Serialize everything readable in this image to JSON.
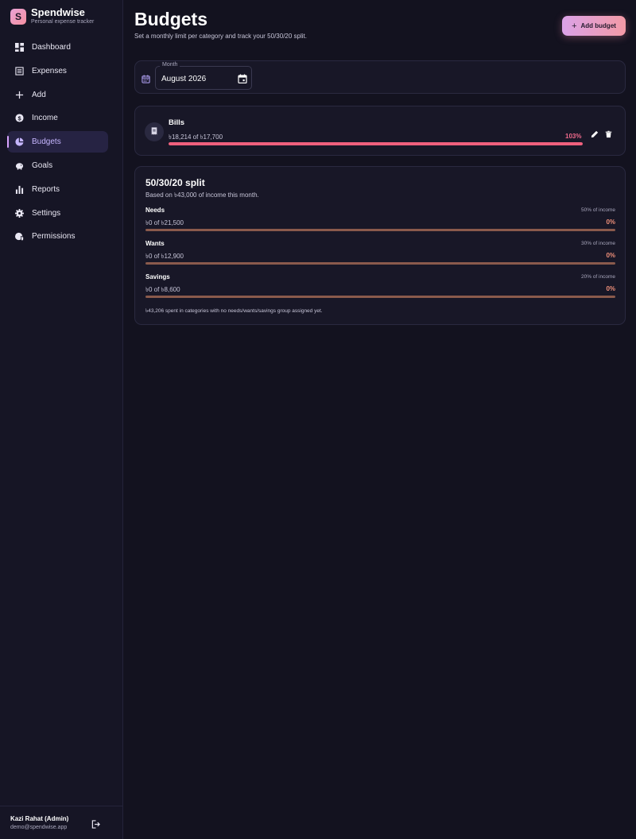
{
  "brand": {
    "logo_letter": "S",
    "name": "Spendwise",
    "tagline": "Personal expense tracker"
  },
  "nav": [
    {
      "label": "Dashboard",
      "icon": "dashboard-icon",
      "active": false
    },
    {
      "label": "Expenses",
      "icon": "receipt-icon",
      "active": false
    },
    {
      "label": "Add",
      "icon": "plus-icon",
      "active": false
    },
    {
      "label": "Income",
      "icon": "dollar-icon",
      "active": false
    },
    {
      "label": "Budgets",
      "icon": "pie-chart-icon",
      "active": true
    },
    {
      "label": "Goals",
      "icon": "piggy-bank-icon",
      "active": false
    },
    {
      "label": "Reports",
      "icon": "bar-chart-icon",
      "active": false
    },
    {
      "label": "Settings",
      "icon": "gear-icon",
      "active": false
    },
    {
      "label": "Permissions",
      "icon": "user-shield-icon",
      "active": false
    }
  ],
  "user": {
    "name": "Kazi Rahat (Admin)",
    "email": "demo@spendwise.app"
  },
  "header": {
    "title": "Budgets",
    "subtitle": "Set a monthly limit per category and track your 50/30/20 split.",
    "add_button": "Add budget"
  },
  "month": {
    "label": "Month",
    "value": "August 2026"
  },
  "budgets": [
    {
      "name": "Bills",
      "amount": "৳18,214 of ৳17,700",
      "percent_label": "103%",
      "progress": 1.0
    }
  ],
  "split": {
    "title": "50/30/20 split",
    "subtitle": "Based on ৳43,000 of income this month.",
    "rows": [
      {
        "name": "Needs",
        "share": "50% of income",
        "amount": "৳0 of ৳21,500",
        "percent_label": "0%",
        "progress": 0
      },
      {
        "name": "Wants",
        "share": "30% of income",
        "amount": "৳0 of ৳12,900",
        "percent_label": "0%",
        "progress": 0
      },
      {
        "name": "Savings",
        "share": "20% of income",
        "amount": "৳0 of ৳8,600",
        "percent_label": "0%",
        "progress": 0
      }
    ],
    "note": "৳43,206 spent in categories with no needs/wants/savings group assigned yet."
  },
  "colors": {
    "background": "#13121f",
    "accent": "#c6b6ff",
    "over_budget": "#f0607d",
    "split_fill": "#f0907a"
  }
}
